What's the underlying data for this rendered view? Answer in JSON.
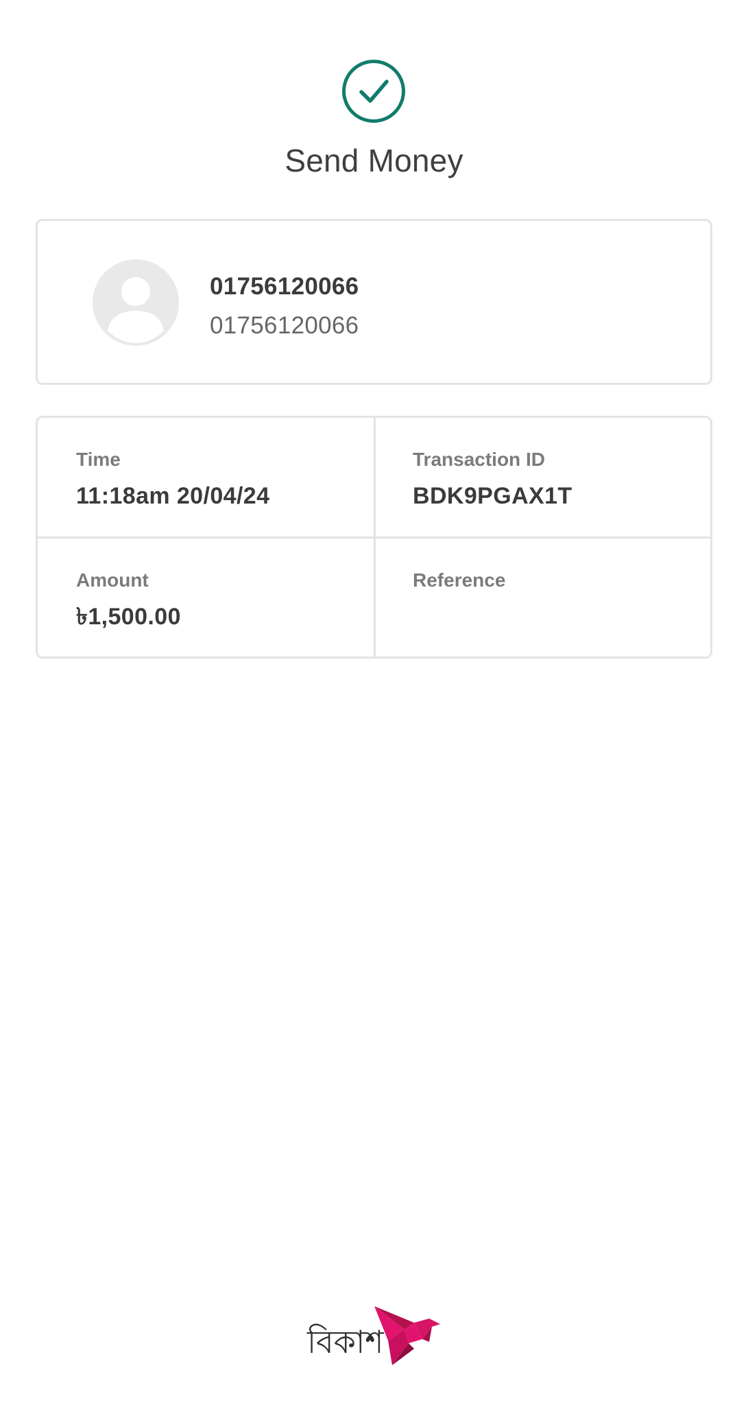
{
  "header": {
    "title": "Send Money",
    "status_icon": "check-circle-icon",
    "accent_color": "#117c6b"
  },
  "recipient": {
    "avatar_icon": "person-placeholder-icon",
    "name": "01756120066",
    "number": "01756120066"
  },
  "details": {
    "time_label": "Time",
    "time_value": "11:18am 20/04/24",
    "transaction_id_label": "Transaction ID",
    "transaction_id_value": "BDK9PGAX1T",
    "amount_label": "Amount",
    "amount_value": "৳1,500.00",
    "reference_label": "Reference",
    "reference_value": ""
  },
  "footer": {
    "logo_text": "বিকাশ",
    "brand_color": "#e2136e",
    "logo_icon": "bkash-bird-logo-icon"
  }
}
